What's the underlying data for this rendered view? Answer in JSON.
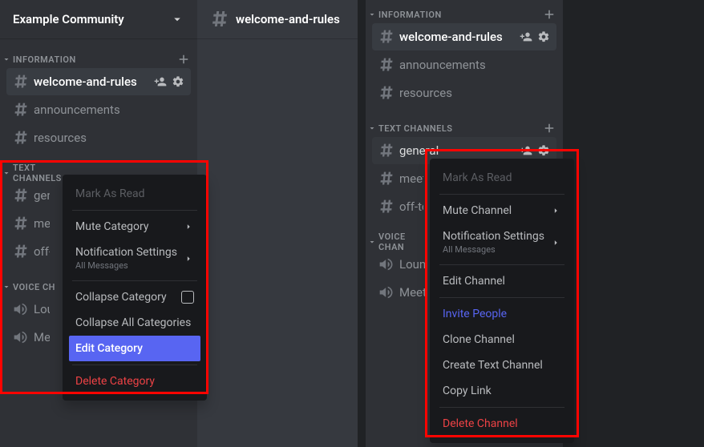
{
  "left": {
    "server_name": "Example Community",
    "open_channel": "welcome-and-rules",
    "categories": [
      {
        "name": "INFORMATION",
        "channels": [
          {
            "name": "welcome-and-rules",
            "type": "text",
            "selected": true
          },
          {
            "name": "announcements",
            "type": "text"
          },
          {
            "name": "resources",
            "type": "text"
          }
        ]
      },
      {
        "name": "TEXT CHANNELS",
        "truncated": true,
        "channels": [
          {
            "name": "gene",
            "type": "text"
          },
          {
            "name": "meet",
            "type": "text"
          },
          {
            "name": "off-t",
            "type": "text"
          }
        ]
      },
      {
        "name": "VOICE CH",
        "truncated": true,
        "channels": [
          {
            "name": "Loun",
            "type": "voice"
          },
          {
            "name": "Me",
            "type": "voice"
          }
        ]
      }
    ],
    "context_menu": {
      "mark_as_read": "Mark As Read",
      "mute_category": "Mute Category",
      "notification_settings": "Notification Settings",
      "notification_sub": "All Messages",
      "collapse_category": "Collapse Category",
      "collapse_all": "Collapse All Categories",
      "edit_category": "Edit Category",
      "delete_category": "Delete Category"
    }
  },
  "right": {
    "categories": [
      {
        "name": "INFORMATION",
        "channels": [
          {
            "name": "welcome-and-rules",
            "type": "text",
            "selected": true
          },
          {
            "name": "announcements",
            "type": "text"
          },
          {
            "name": "resources",
            "type": "text"
          }
        ]
      },
      {
        "name": "TEXT CHANNELS",
        "channels": [
          {
            "name": "general",
            "type": "text",
            "hover": true
          },
          {
            "name": "meetin",
            "type": "text"
          },
          {
            "name": "off-top",
            "type": "text"
          }
        ]
      },
      {
        "name": "VOICE CHAN",
        "truncated": true,
        "channels": [
          {
            "name": "Lounge",
            "type": "voice"
          },
          {
            "name": "Meetir",
            "type": "voice"
          }
        ]
      }
    ],
    "context_menu": {
      "mark_as_read": "Mark As Read",
      "mute_channel": "Mute Channel",
      "notification_settings": "Notification Settings",
      "notification_sub": "All Messages",
      "edit_channel": "Edit Channel",
      "invite_people": "Invite People",
      "clone_channel": "Clone Channel",
      "create_text_channel": "Create Text Channel",
      "copy_link": "Copy Link",
      "delete_channel": "Delete Channel"
    }
  }
}
